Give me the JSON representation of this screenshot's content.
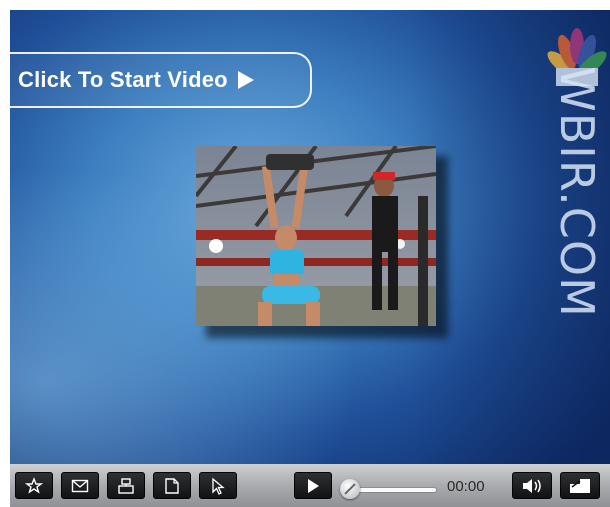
{
  "player": {
    "start_button_label": "Click To Start Video",
    "brand_text": "WBIR.COM",
    "thumbnail_alt": "Video thumbnail"
  },
  "controls": {
    "time": "00:00",
    "progress": 0,
    "buttons": {
      "favorite": "star-icon",
      "email": "envelope-icon",
      "share": "share-icon",
      "page": "page-icon",
      "cursor": "cursor-icon",
      "play": "play-icon",
      "volume": "speaker-icon",
      "fullscreen": "fullscreen-icon"
    }
  },
  "colors": {
    "background_blue": "#1f4f98",
    "control_bar_gray": "#a9abaf",
    "button_black": "#1a1b1c"
  }
}
